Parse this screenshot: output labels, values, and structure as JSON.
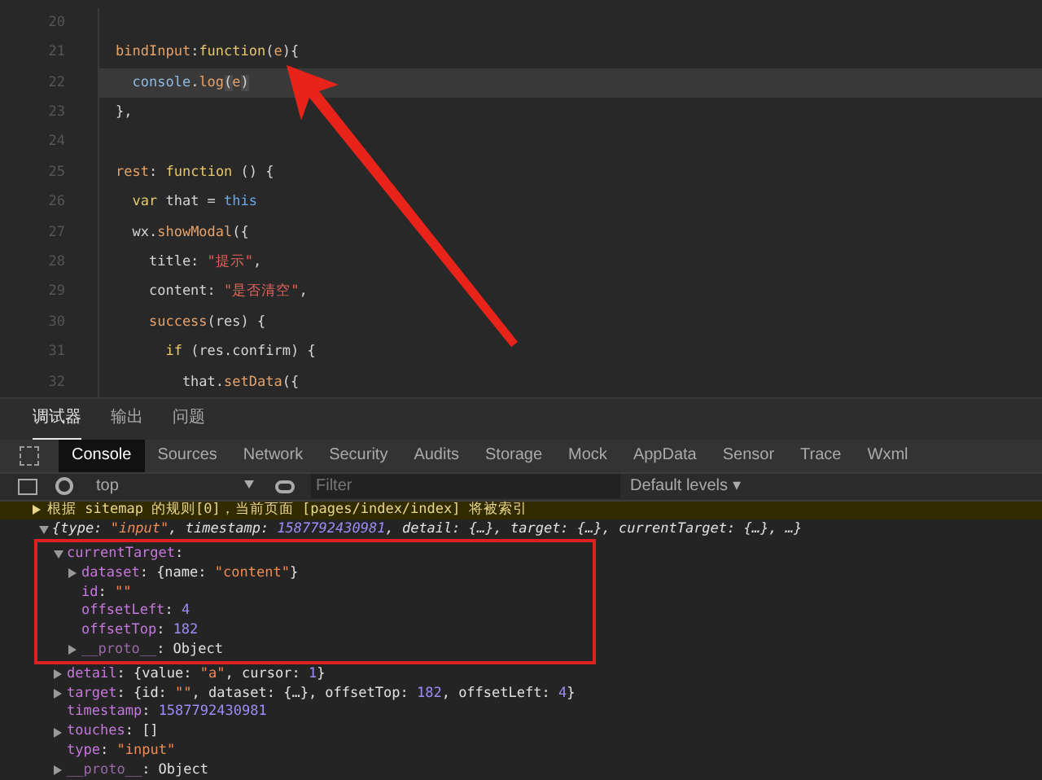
{
  "editor": {
    "lines": [
      {
        "number": "20"
      },
      {
        "number": "21",
        "tokens": [
          {
            "text": "bindInput",
            "kind": "prop"
          },
          {
            "text": ":",
            "kind": "punct"
          },
          {
            "text": "function",
            "kind": "keyword"
          },
          {
            "text": "(",
            "kind": "punct"
          },
          {
            "text": "e",
            "kind": "param"
          },
          {
            "text": "){",
            "kind": "punct"
          }
        ]
      },
      {
        "number": "22",
        "active": true,
        "tokens": [
          {
            "text": "  console",
            "kind": "object"
          },
          {
            "text": ".",
            "kind": "punct"
          },
          {
            "text": "log",
            "kind": "method"
          },
          {
            "text": "(",
            "kind": "bracket"
          },
          {
            "text": "e",
            "kind": "param"
          },
          {
            "text": ")",
            "kind": "bracket"
          }
        ]
      },
      {
        "number": "23",
        "tokens": [
          {
            "text": "},",
            "kind": "punct"
          }
        ]
      },
      {
        "number": "24"
      },
      {
        "number": "25",
        "tokens": [
          {
            "text": "rest",
            "kind": "prop"
          },
          {
            "text": ": ",
            "kind": "punct"
          },
          {
            "text": "function",
            "kind": "keyword"
          },
          {
            "text": " () {",
            "kind": "punct"
          }
        ]
      },
      {
        "number": "26",
        "tokens": [
          {
            "text": "  var",
            "kind": "keyword"
          },
          {
            "text": " that = ",
            "kind": "plain"
          },
          {
            "text": "this",
            "kind": "this"
          }
        ]
      },
      {
        "number": "27",
        "tokens": [
          {
            "text": "  wx.",
            "kind": "plain"
          },
          {
            "text": "showModal",
            "kind": "method"
          },
          {
            "text": "({",
            "kind": "punct"
          }
        ]
      },
      {
        "number": "28",
        "tokens": [
          {
            "text": "    title: ",
            "kind": "plain"
          },
          {
            "text": "\"提示\"",
            "kind": "string"
          },
          {
            "text": ",",
            "kind": "punct"
          }
        ]
      },
      {
        "number": "29",
        "tokens": [
          {
            "text": "    content: ",
            "kind": "plain"
          },
          {
            "text": "\"是否清空\"",
            "kind": "string"
          },
          {
            "text": ",",
            "kind": "punct"
          }
        ]
      },
      {
        "number": "30",
        "tokens": [
          {
            "text": "    success",
            "kind": "method"
          },
          {
            "text": "(res) {",
            "kind": "punct"
          }
        ]
      },
      {
        "number": "31",
        "tokens": [
          {
            "text": "      if",
            "kind": "keyword"
          },
          {
            "text": " (res.confirm) {",
            "kind": "punct"
          }
        ]
      },
      {
        "number": "32",
        "tokens": [
          {
            "text": "        that.",
            "kind": "plain"
          },
          {
            "text": "setData",
            "kind": "method"
          },
          {
            "text": "({",
            "kind": "punct"
          }
        ]
      }
    ]
  },
  "panel_tabs": [
    {
      "label": "调试器",
      "selected": true
    },
    {
      "label": "输出",
      "selected": false
    },
    {
      "label": "问题",
      "selected": false
    }
  ],
  "devtools_tabs": [
    {
      "label": "Console",
      "selected": true
    },
    {
      "label": "Sources",
      "selected": false
    },
    {
      "label": "Network",
      "selected": false
    },
    {
      "label": "Security",
      "selected": false
    },
    {
      "label": "Audits",
      "selected": false
    },
    {
      "label": "Storage",
      "selected": false
    },
    {
      "label": "Mock",
      "selected": false
    },
    {
      "label": "AppData",
      "selected": false
    },
    {
      "label": "Sensor",
      "selected": false
    },
    {
      "label": "Trace",
      "selected": false
    },
    {
      "label": "Wxml",
      "selected": false
    }
  ],
  "console_toolbar": {
    "context": "top",
    "filter_placeholder": "Filter",
    "levels": "Default levels ▾"
  },
  "console": {
    "warning": "根据 sitemap 的规则[0]，当前页面 [pages/index/index] 将被索引",
    "entries": [
      {
        "italic": true,
        "expanded": true,
        "segments": [
          {
            "text": "{type: ",
            "kind": "punct"
          },
          {
            "text": "\"input\"",
            "kind": "string"
          },
          {
            "text": ", timestamp: ",
            "kind": "punct"
          },
          {
            "text": "1587792430981",
            "kind": "number"
          },
          {
            "text": ", detail: {…}, target: {…}, currentTarget: {…}, …}",
            "kind": "punct"
          }
        ],
        "children": [
          {
            "expanded": true,
            "highlighted": true,
            "segments": [
              {
                "text": "currentTarget",
                "kind": "key"
              },
              {
                "text": ":",
                "kind": "punct"
              }
            ],
            "children": [
              {
                "expanded": false,
                "segments": [
                  {
                    "text": "dataset",
                    "kind": "key"
                  },
                  {
                    "text": ": {name: ",
                    "kind": "punct"
                  },
                  {
                    "text": "\"content\"",
                    "kind": "string"
                  },
                  {
                    "text": "}",
                    "kind": "punct"
                  }
                ]
              },
              {
                "segments": [
                  {
                    "text": "id",
                    "kind": "key"
                  },
                  {
                    "text": ": ",
                    "kind": "punct"
                  },
                  {
                    "text": "\"\"",
                    "kind": "string"
                  }
                ]
              },
              {
                "segments": [
                  {
                    "text": "offsetLeft",
                    "kind": "key"
                  },
                  {
                    "text": ": ",
                    "kind": "punct"
                  },
                  {
                    "text": "4",
                    "kind": "number"
                  }
                ]
              },
              {
                "segments": [
                  {
                    "text": "offsetTop",
                    "kind": "key"
                  },
                  {
                    "text": ": ",
                    "kind": "punct"
                  },
                  {
                    "text": "182",
                    "kind": "number"
                  }
                ]
              },
              {
                "expanded": false,
                "segments": [
                  {
                    "text": "__proto__",
                    "kind": "dimkey"
                  },
                  {
                    "text": ": Object",
                    "kind": "punct"
                  }
                ]
              }
            ]
          },
          {
            "expanded": false,
            "segments": [
              {
                "text": "detail",
                "kind": "key"
              },
              {
                "text": ": {value: ",
                "kind": "punct"
              },
              {
                "text": "\"a\"",
                "kind": "string"
              },
              {
                "text": ", cursor: ",
                "kind": "punct"
              },
              {
                "text": "1",
                "kind": "number"
              },
              {
                "text": "}",
                "kind": "punct"
              }
            ]
          },
          {
            "expanded": false,
            "segments": [
              {
                "text": "target",
                "kind": "key"
              },
              {
                "text": ": {id: ",
                "kind": "punct"
              },
              {
                "text": "\"\"",
                "kind": "string"
              },
              {
                "text": ", dataset: {…}, offsetTop: ",
                "kind": "punct"
              },
              {
                "text": "182",
                "kind": "number"
              },
              {
                "text": ", offsetLeft: ",
                "kind": "punct"
              },
              {
                "text": "4",
                "kind": "number"
              },
              {
                "text": "}",
                "kind": "punct"
              }
            ]
          },
          {
            "segments": [
              {
                "text": "timestamp",
                "kind": "key"
              },
              {
                "text": ": ",
                "kind": "punct"
              },
              {
                "text": "1587792430981",
                "kind": "number"
              }
            ]
          },
          {
            "expanded": false,
            "segments": [
              {
                "text": "touches",
                "kind": "key"
              },
              {
                "text": ": []",
                "kind": "punct"
              }
            ]
          },
          {
            "segments": [
              {
                "text": "type",
                "kind": "key"
              },
              {
                "text": ": ",
                "kind": "punct"
              },
              {
                "text": "\"input\"",
                "kind": "string"
              }
            ]
          },
          {
            "expanded": false,
            "segments": [
              {
                "text": "__proto__",
                "kind": "dimkey"
              },
              {
                "text": ": Object",
                "kind": "punct"
              }
            ]
          }
        ]
      }
    ]
  }
}
